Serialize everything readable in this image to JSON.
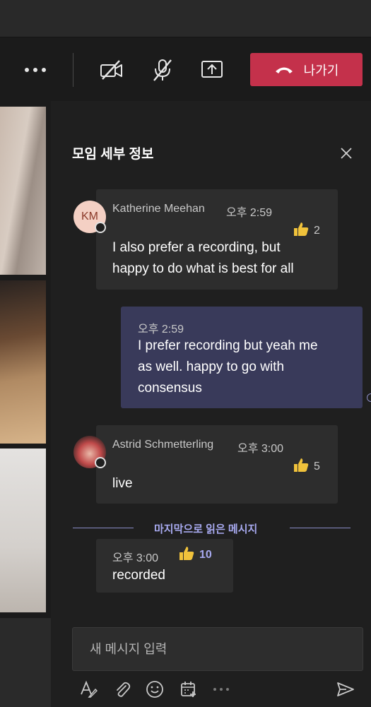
{
  "toolbar": {
    "more_icon": "more-horizontal-icon",
    "camera_icon": "camera-off-icon",
    "mic_icon": "mic-off-icon",
    "share_icon": "share-screen-icon",
    "leave_label": "나가기",
    "leave_color": "#c4314b"
  },
  "panel": {
    "title": "모임 세부 정보",
    "close_icon": "close-icon"
  },
  "messages": [
    {
      "sender": "Katherine Meehan",
      "initials": "KM",
      "time": "오후 2:59",
      "reaction": "like",
      "reaction_count": "2",
      "lines": [
        "I also prefer a recording, but",
        "happy to do what is best for all"
      ]
    },
    {
      "sender": "",
      "time": "오후 2:59",
      "lines": [
        "I prefer recording but yeah me",
        "as well. happy to go with",
        "consensus"
      ],
      "own": true
    },
    {
      "sender": "Astrid Schmetterling",
      "time": "오후 3:00",
      "reaction": "like",
      "reaction_count": "5",
      "lines": [
        "live"
      ]
    },
    {
      "sender": "",
      "time": "오후 3:00",
      "reaction": "like",
      "reaction_count": "10",
      "lines": [
        "recorded"
      ]
    }
  ],
  "divider_label": "마지막으로 읽은 메시지",
  "compose": {
    "placeholder": "새 메시지 입력",
    "icons": [
      "format-icon",
      "attach-icon",
      "emoji-icon",
      "schedule-meeting-icon",
      "more-horizontal-icon",
      "send-icon"
    ]
  },
  "colors": {
    "accent": "#8b8cc7",
    "own_bubble": "#393a5a",
    "bubble": "#2d2d2d",
    "leave": "#c4314b"
  }
}
